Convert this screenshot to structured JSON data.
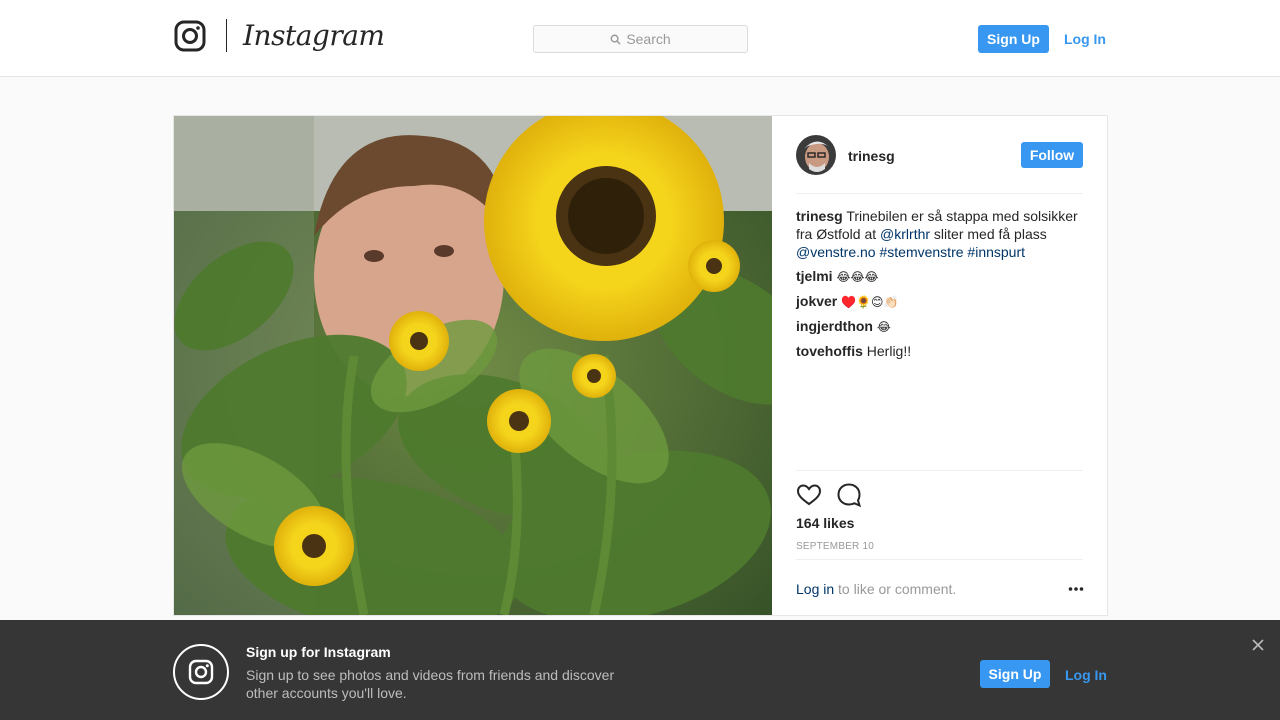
{
  "header": {
    "wordmark": "Instagram",
    "search_placeholder": "Search",
    "signup_label": "Sign Up",
    "login_label": "Log In"
  },
  "post": {
    "author": "trinesg",
    "follow_label": "Follow",
    "caption": {
      "user": "trinesg",
      "text_1": "Trinebilen er så stappa med solsikker fra Østfold at",
      "mention_1": "@krlrthr",
      "text_2": "sliter med få plass",
      "mention_2": "@venstre.no",
      "hashtag_1": "#stemvenstre",
      "hashtag_2": "#innspurt"
    },
    "comments": [
      {
        "user": "tjelmi",
        "text": "😂😂😂"
      },
      {
        "user": "jokver",
        "text": "♥️🌻😊👏🏻"
      },
      {
        "user": "ingjerdthon",
        "text": "😂"
      },
      {
        "user": "tovehoffis",
        "text": "Herlig!!"
      }
    ],
    "likes": "164 likes",
    "date": "SEPTEMBER 10",
    "login_link": "Log in",
    "login_suffix": "to like or comment."
  },
  "banner": {
    "title": "Sign up for Instagram",
    "text": "Sign up to see photos and videos from friends and discover other accounts you'll love.",
    "signup_label": "Sign Up",
    "login_label": "Log In"
  },
  "colors": {
    "accent": "#3897f0",
    "link": "#003569",
    "banner_bg": "#363636"
  }
}
